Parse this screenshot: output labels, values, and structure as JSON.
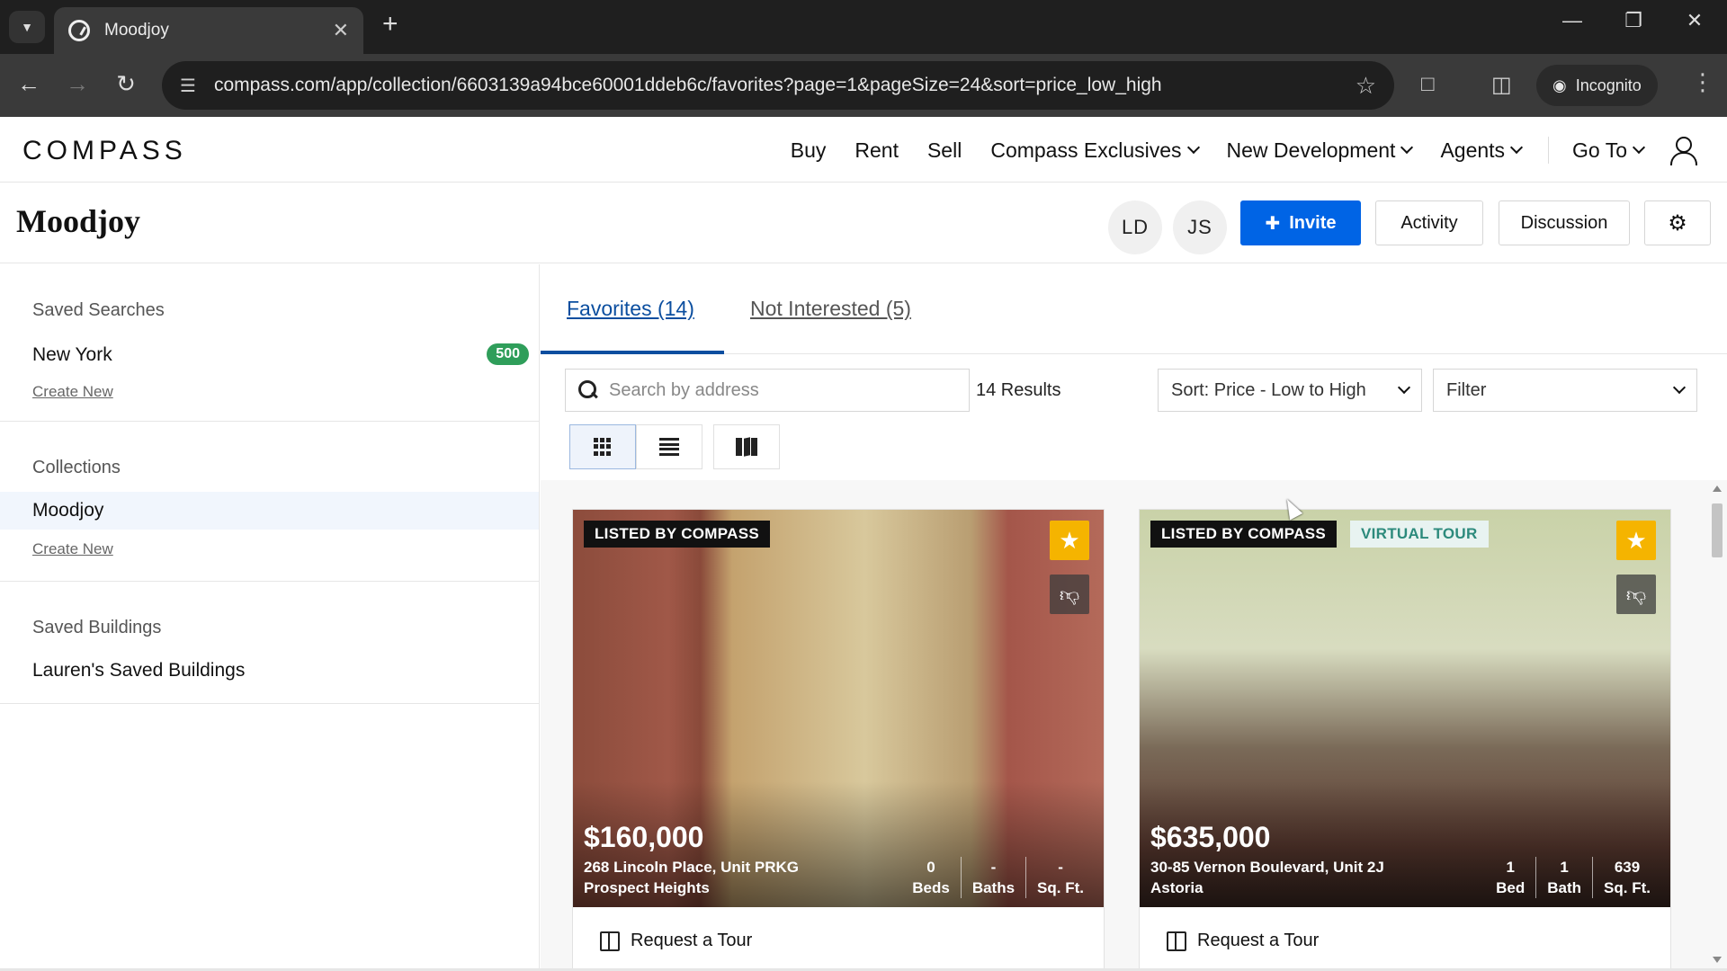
{
  "browser": {
    "tab_title": "Moodjoy",
    "url": "compass.com/app/collection/6603139a94bce60001ddeb6c/favorites?page=1&pageSize=24&sort=price_low_high",
    "incognito_label": "Incognito",
    "new_tab": "+",
    "close_tab": "✕"
  },
  "site": {
    "logo": "COMPASS",
    "nav": {
      "buy": "Buy",
      "rent": "Rent",
      "sell": "Sell",
      "exclusives": "Compass Exclusives",
      "new_dev": "New Development",
      "agents": "Agents",
      "go_to": "Go To"
    }
  },
  "collection": {
    "title": "Moodjoy",
    "avatars": [
      "LD",
      "JS"
    ],
    "invite_label": "Invite",
    "activity_label": "Activity",
    "discussion_label": "Discussion"
  },
  "sidebar": {
    "saved_searches": {
      "heading": "Saved Searches",
      "items": [
        {
          "label": "New York",
          "count": "500"
        }
      ],
      "create_new": "Create New"
    },
    "collections": {
      "heading": "Collections",
      "items": [
        {
          "label": "Moodjoy"
        }
      ],
      "create_new": "Create New"
    },
    "saved_buildings": {
      "heading": "Saved Buildings",
      "items": [
        {
          "label": "Lauren's Saved Buildings"
        }
      ]
    }
  },
  "main": {
    "tabs": [
      {
        "label": "Favorites (14)"
      },
      {
        "label": "Not Interested (5)"
      }
    ],
    "search_placeholder": "Search by address",
    "results_count": "14 Results",
    "sort_label": "Sort: Price - Low to High",
    "filter_label": "Filter"
  },
  "listings": [
    {
      "tag": "LISTED BY COMPASS",
      "price": "$160,000",
      "address": "268 Lincoln Place, Unit PRKG",
      "neighborhood": "Prospect Heights",
      "beds_value": "0",
      "beds_label": "Beds",
      "baths_value": "-",
      "baths_label": "Baths",
      "sqft_value": "-",
      "sqft_label": "Sq. Ft.",
      "tour_label": "Request a Tour"
    },
    {
      "tag": "LISTED BY COMPASS",
      "tag2": "VIRTUAL TOUR",
      "price": "$635,000",
      "address": "30-85 Vernon Boulevard, Unit 2J",
      "neighborhood": "Astoria",
      "beds_value": "1",
      "beds_label": "Bed",
      "baths_value": "1",
      "baths_label": "Bath",
      "sqft_value": "639",
      "sqft_label": "Sq. Ft.",
      "tour_label": "Request a Tour"
    }
  ],
  "colors": {
    "primary": "#0064e5",
    "active_tab": "#0b4e9f",
    "badge": "#2f9e5a",
    "favorite": "#f5b400"
  }
}
